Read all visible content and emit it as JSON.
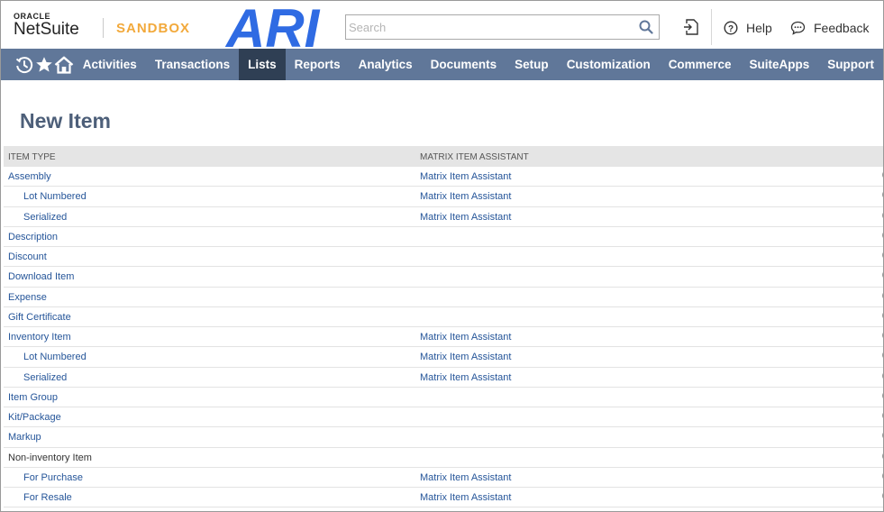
{
  "header": {
    "logo_brand": "ORACLE",
    "logo_product": "NetSuite",
    "environment": "SANDBOX",
    "overlay_logo": "ARI",
    "search_placeholder": "Search",
    "help_label": "Help",
    "feedback_label": "Feedback"
  },
  "nav": {
    "icons": [
      "recent-records-icon",
      "favorites-star-icon",
      "home-icon"
    ],
    "items": [
      {
        "label": "Activities",
        "active": false
      },
      {
        "label": "Transactions",
        "active": false
      },
      {
        "label": "Lists",
        "active": true
      },
      {
        "label": "Reports",
        "active": false
      },
      {
        "label": "Analytics",
        "active": false
      },
      {
        "label": "Documents",
        "active": false
      },
      {
        "label": "Setup",
        "active": false
      },
      {
        "label": "Customization",
        "active": false
      },
      {
        "label": "Commerce",
        "active": false
      },
      {
        "label": "SuiteApps",
        "active": false
      },
      {
        "label": "Support",
        "active": false
      }
    ]
  },
  "page": {
    "title": "New Item"
  },
  "table": {
    "columns": [
      "ITEM TYPE",
      "MATRIX ITEM ASSISTANT"
    ],
    "rows": [
      {
        "type": "Assembly",
        "indent": 0,
        "link": true,
        "matrix": "Matrix Item Assistant"
      },
      {
        "type": "Lot Numbered",
        "indent": 1,
        "link": true,
        "matrix": "Matrix Item Assistant"
      },
      {
        "type": "Serialized",
        "indent": 1,
        "link": true,
        "matrix": "Matrix Item Assistant"
      },
      {
        "type": "Description",
        "indent": 0,
        "link": true,
        "matrix": ""
      },
      {
        "type": "Discount",
        "indent": 0,
        "link": true,
        "matrix": ""
      },
      {
        "type": "Download Item",
        "indent": 0,
        "link": true,
        "matrix": ""
      },
      {
        "type": "Expense",
        "indent": 0,
        "link": true,
        "matrix": ""
      },
      {
        "type": "Gift Certificate",
        "indent": 0,
        "link": true,
        "matrix": ""
      },
      {
        "type": "Inventory Item",
        "indent": 0,
        "link": true,
        "matrix": "Matrix Item Assistant"
      },
      {
        "type": "Lot Numbered",
        "indent": 1,
        "link": true,
        "matrix": "Matrix Item Assistant"
      },
      {
        "type": "Serialized",
        "indent": 1,
        "link": true,
        "matrix": "Matrix Item Assistant"
      },
      {
        "type": "Item Group",
        "indent": 0,
        "link": true,
        "matrix": ""
      },
      {
        "type": "Kit/Package",
        "indent": 0,
        "link": true,
        "matrix": ""
      },
      {
        "type": "Markup",
        "indent": 0,
        "link": true,
        "matrix": ""
      },
      {
        "type": "Non-inventory Item",
        "indent": 0,
        "link": false,
        "matrix": ""
      },
      {
        "type": "For Purchase",
        "indent": 1,
        "link": true,
        "matrix": "Matrix Item Assistant"
      },
      {
        "type": "For Resale",
        "indent": 1,
        "link": true,
        "matrix": "Matrix Item Assistant"
      }
    ]
  },
  "colors": {
    "nav_bg": "#607799",
    "nav_active": "#2f3f54",
    "link": "#255599",
    "title": "#4d5f79",
    "sandbox": "#f2a93b",
    "ari_blue": "#2f6be3"
  }
}
